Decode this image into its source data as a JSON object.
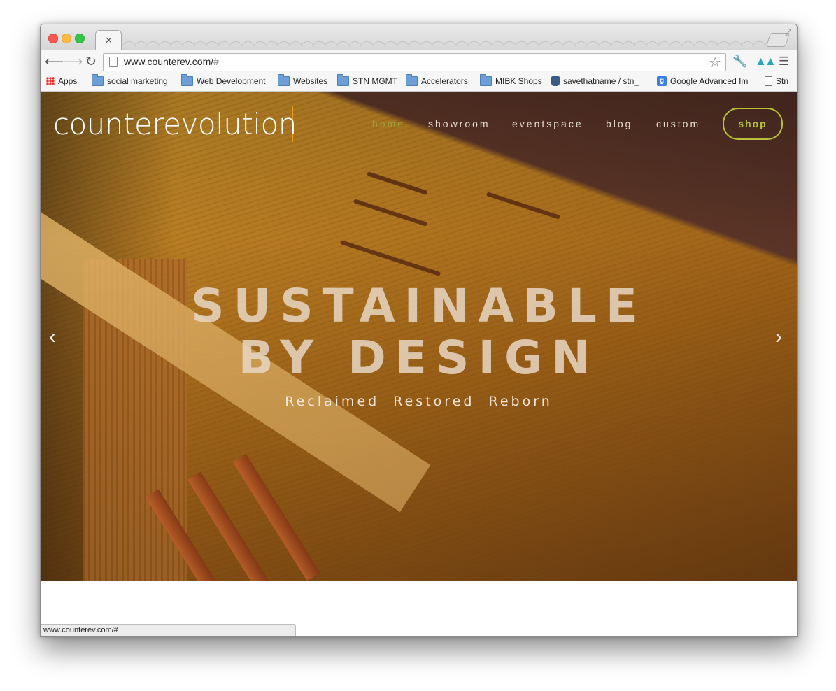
{
  "browser": {
    "url": "www.counterev.com/",
    "url_hash": "#",
    "bookmarks": [
      {
        "label": "Apps",
        "icon": "apps-grid-icon"
      },
      {
        "label": "social marketing",
        "icon": "folder-icon"
      },
      {
        "label": "Web Development",
        "icon": "folder-icon"
      },
      {
        "label": "Websites",
        "icon": "folder-icon"
      },
      {
        "label": "STN MGMT",
        "icon": "folder-icon"
      },
      {
        "label": "Accelerators",
        "icon": "folder-icon"
      },
      {
        "label": "MIBK Shops",
        "icon": "folder-icon"
      },
      {
        "label": "savethatname / stn_",
        "icon": "bucket-icon"
      },
      {
        "label": "Google Advanced Im",
        "icon": "google-icon"
      },
      {
        "label": "Stn",
        "icon": "document-icon"
      }
    ],
    "status_text": "www.counterev.com/#"
  },
  "site": {
    "logo": "counterevolution",
    "nav": {
      "home": "home",
      "showroom": "showroom",
      "eventspace": "eventspace",
      "blog": "blog",
      "custom": "custom",
      "shop": "shop"
    },
    "hero": {
      "line1": "SUSTAINABLE",
      "line2": "BY DESIGN",
      "tagline": "Reclaimed  Restored  Reborn"
    }
  },
  "colors": {
    "accent_orange": "#e99a1f",
    "nav_active": "#9aa33b",
    "shop_button": "#b7c23a"
  }
}
